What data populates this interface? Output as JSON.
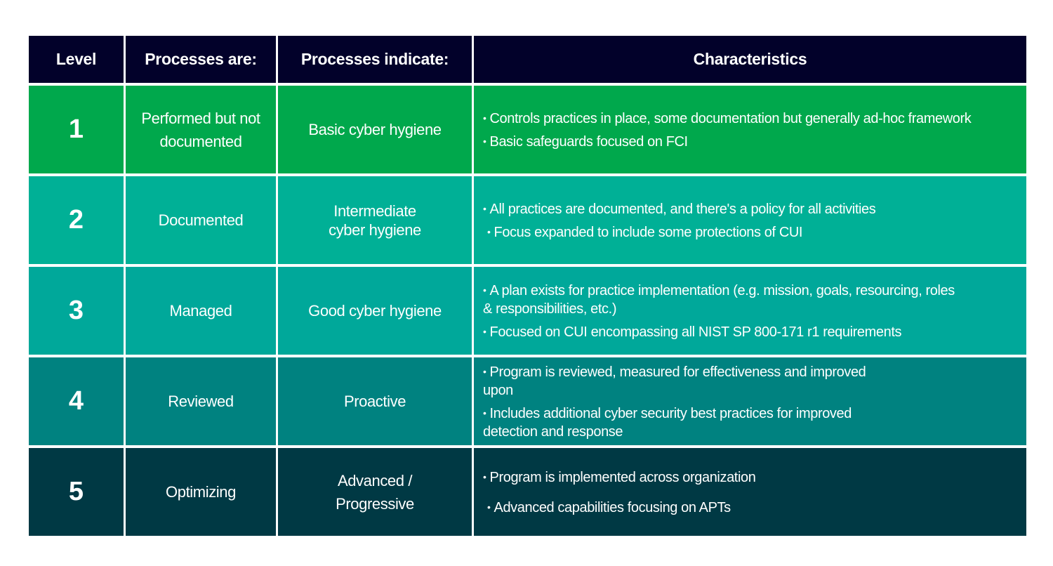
{
  "table": {
    "headers": [
      "Level",
      "Processes are:",
      "Processes  indicate:",
      "Characteristics"
    ],
    "rows": [
      {
        "level": "1",
        "processes_are": "Performed but not documented",
        "processes_indicate": "Basic cyber hygiene",
        "characteristics": [
          "Controls practices in place, some documentation but generally ad-hoc framework",
          "Basic safeguards focused on FCI"
        ],
        "color": "#00a84c"
      },
      {
        "level": "2",
        "processes_are": "Documented",
        "processes_indicate": "Intermediate cyber hygiene",
        "characteristics": [
          "All practices are documented, and there's a policy for all activities",
          "Focus expanded to include some protections of CUI"
        ],
        "color": "#00b096"
      },
      {
        "level": "3",
        "processes_are": "Managed",
        "processes_indicate": "Good cyber hygiene",
        "characteristics": [
          "A plan exists for practice implementation (e.g. mission, goals, resourcing, roles & responsibilities, etc.)",
          "Focused on CUI encompassing all NIST SP 800-171 r1 requirements"
        ],
        "color": "#00a89a"
      },
      {
        "level": "4",
        "processes_are": "Reviewed",
        "processes_indicate": "Proactive",
        "characteristics": [
          "Program is reviewed, measured for effectiveness and improved upon",
          "Includes additional cyber security best practices for improved detection and response"
        ],
        "color": "#008280"
      },
      {
        "level": "5",
        "processes_are": "Optimizing",
        "processes_indicate": "Advanced / Progressive",
        "characteristics": [
          "Program is implemented across organization",
          "Advanced capabilities focusing on APTs"
        ],
        "color": "#003944"
      }
    ],
    "header_color": "#02012a"
  }
}
